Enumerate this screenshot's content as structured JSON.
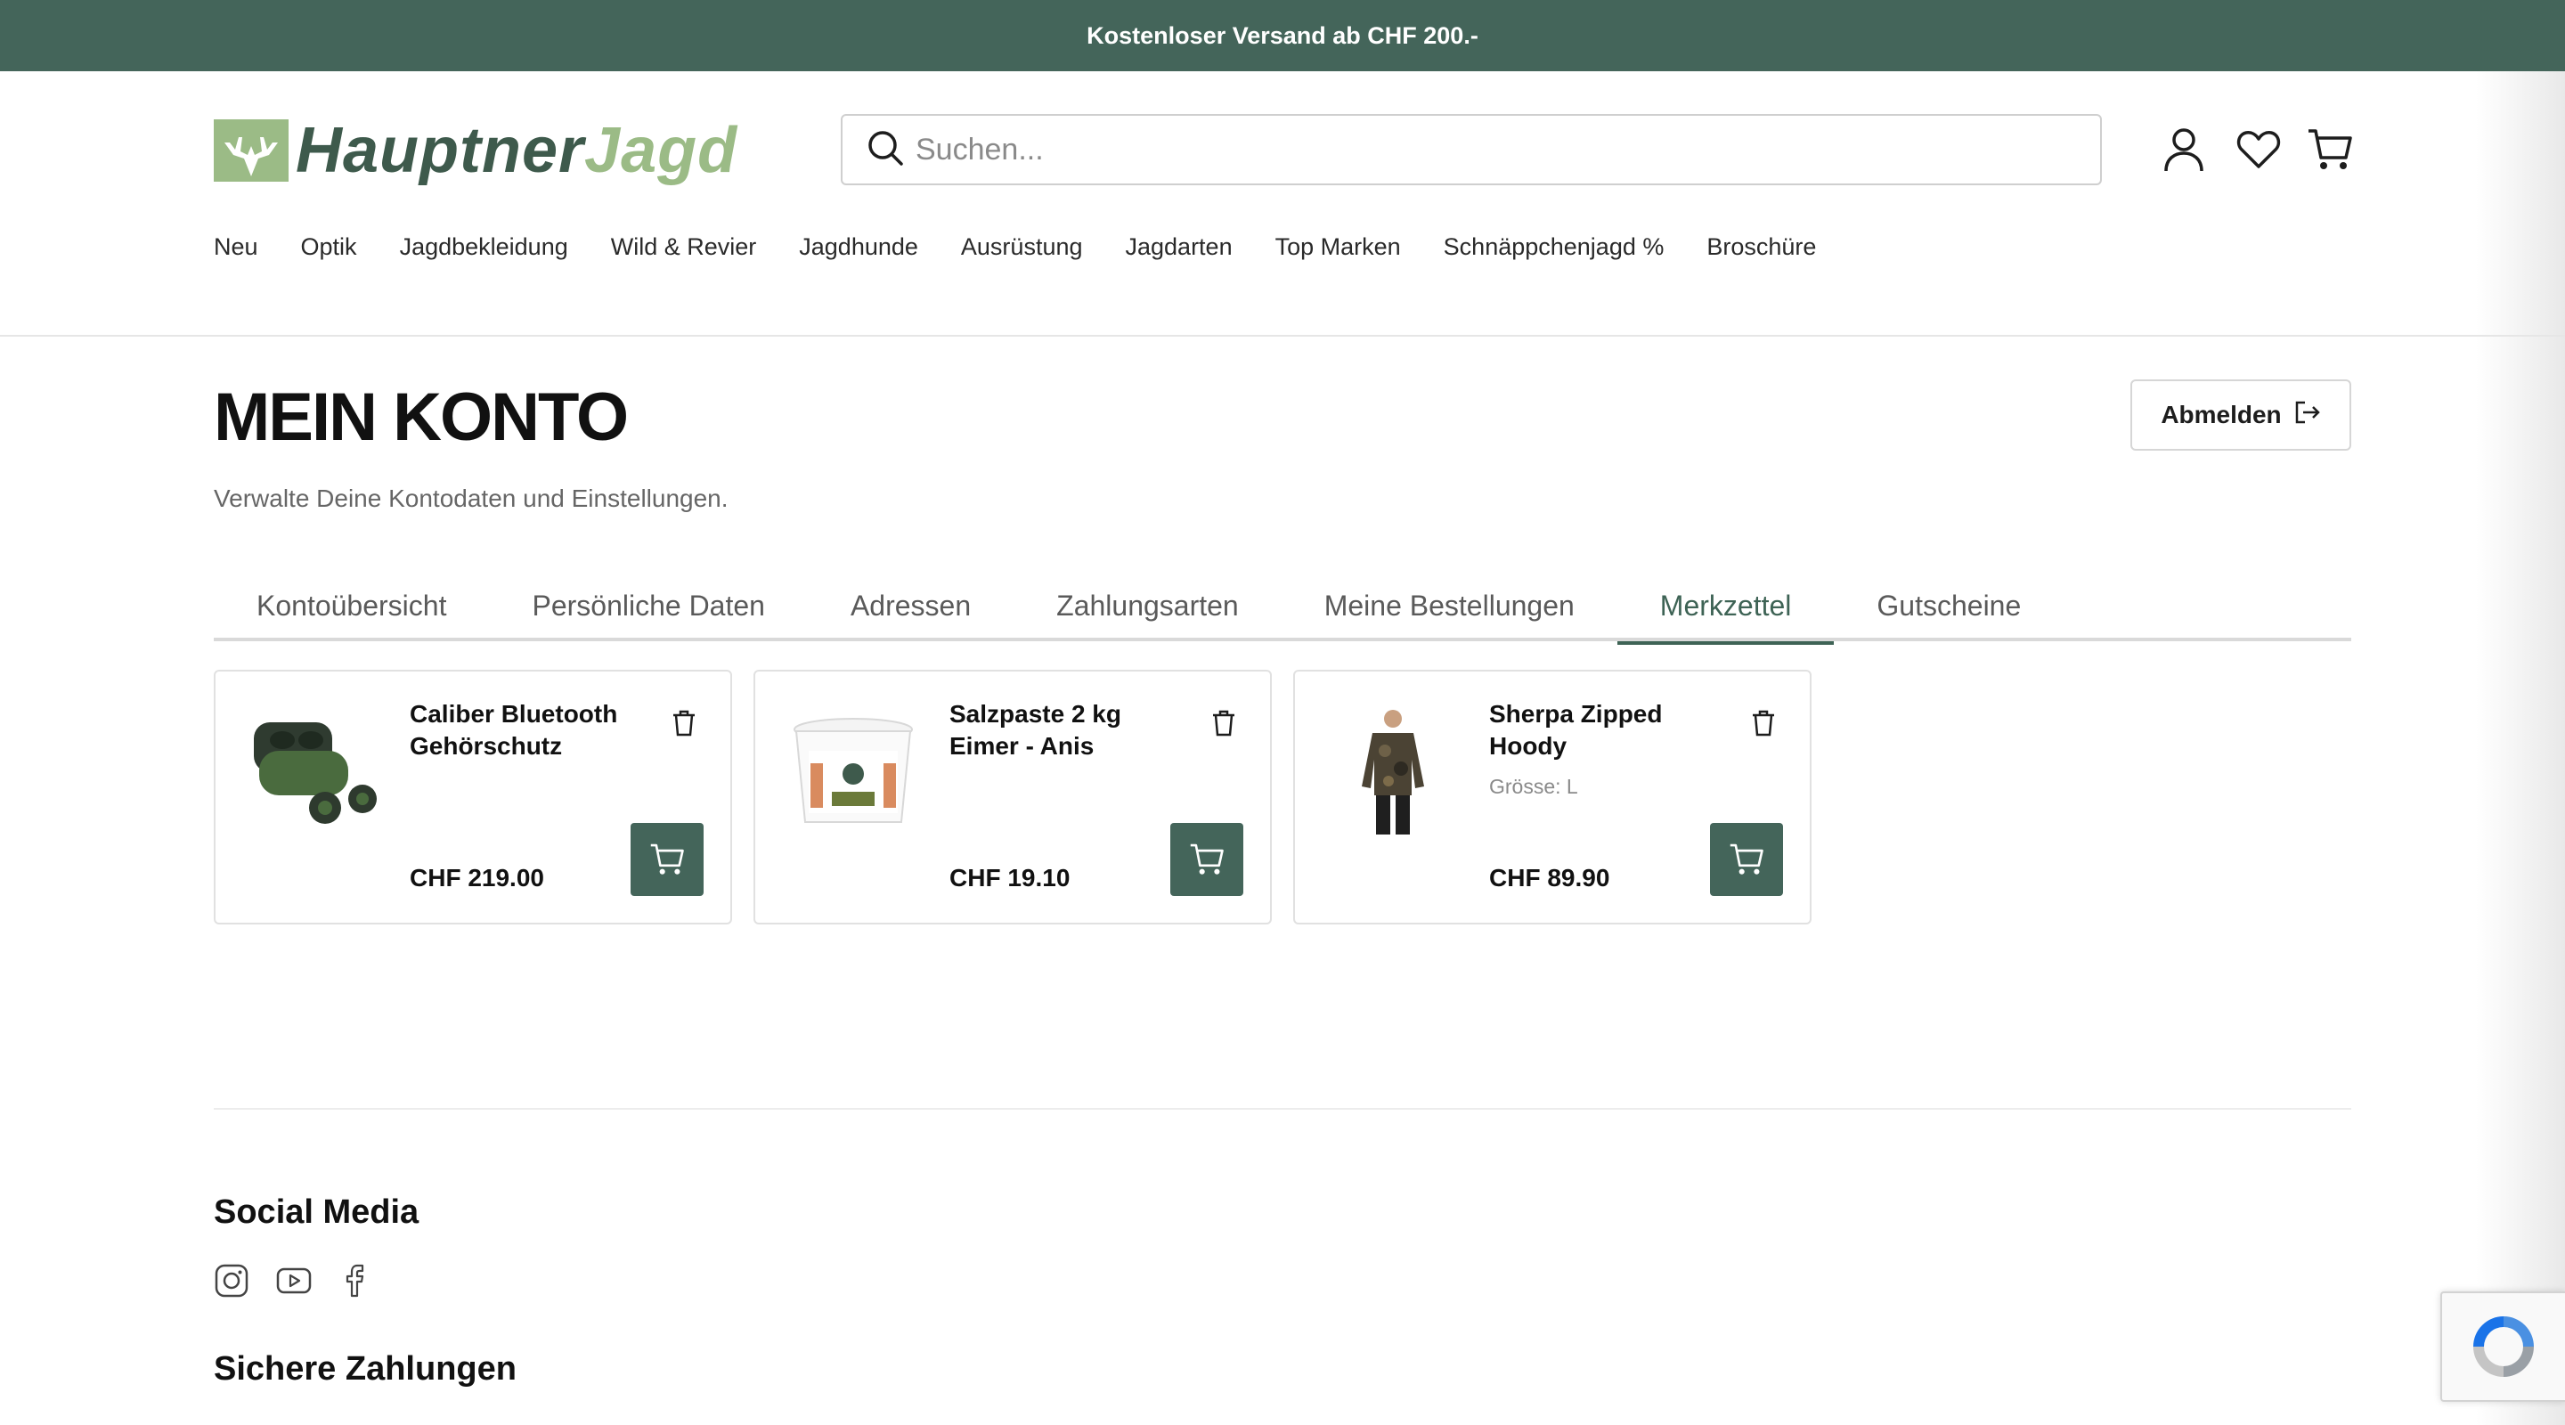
{
  "topbar": {
    "text": "Kostenloser Versand ab CHF 200.-"
  },
  "logo": {
    "part1": "Hauptner",
    "part2": "Jagd"
  },
  "search": {
    "placeholder": "Suchen..."
  },
  "nav": {
    "items": [
      "Neu",
      "Optik",
      "Jagdbekleidung",
      "Wild & Revier",
      "Jagdhunde",
      "Ausrüstung",
      "Jagdarten",
      "Top Marken",
      "Schnäppchenjagd %",
      "Broschüre"
    ]
  },
  "account": {
    "title": "MEIN KONTO",
    "subtitle": "Verwalte Deine Kontodaten und Einstellungen.",
    "logout_label": "Abmelden"
  },
  "tabs": {
    "items": [
      "Kontoübersicht",
      "Persönliche Daten",
      "Adressen",
      "Zahlungsarten",
      "Meine Bestellungen",
      "Merkzettel",
      "Gutscheine"
    ],
    "active": "Merkzettel"
  },
  "wishlist": [
    {
      "name": "Caliber Bluetooth Gehörschutz",
      "variant": "",
      "price": "CHF 219.00",
      "image_icon": "earbuds-icon"
    },
    {
      "name": "Salzpaste 2 kg Eimer - Anis",
      "variant": "",
      "price": "CHF 19.10",
      "image_icon": "bucket-icon"
    },
    {
      "name": "Sherpa Zipped Hoody",
      "variant": "Grösse: L",
      "price": "CHF 89.90",
      "image_icon": "hoody-icon"
    }
  ],
  "footer": {
    "social_title": "Social Media",
    "social_icons": [
      "instagram-icon",
      "youtube-icon",
      "facebook-icon"
    ],
    "payments_title": "Sichere Zahlungen"
  },
  "colors": {
    "brand": "#44655a",
    "active_tab": "#3e6355",
    "logo_dark": "#3e5a4c",
    "logo_light": "#9bbb86"
  }
}
